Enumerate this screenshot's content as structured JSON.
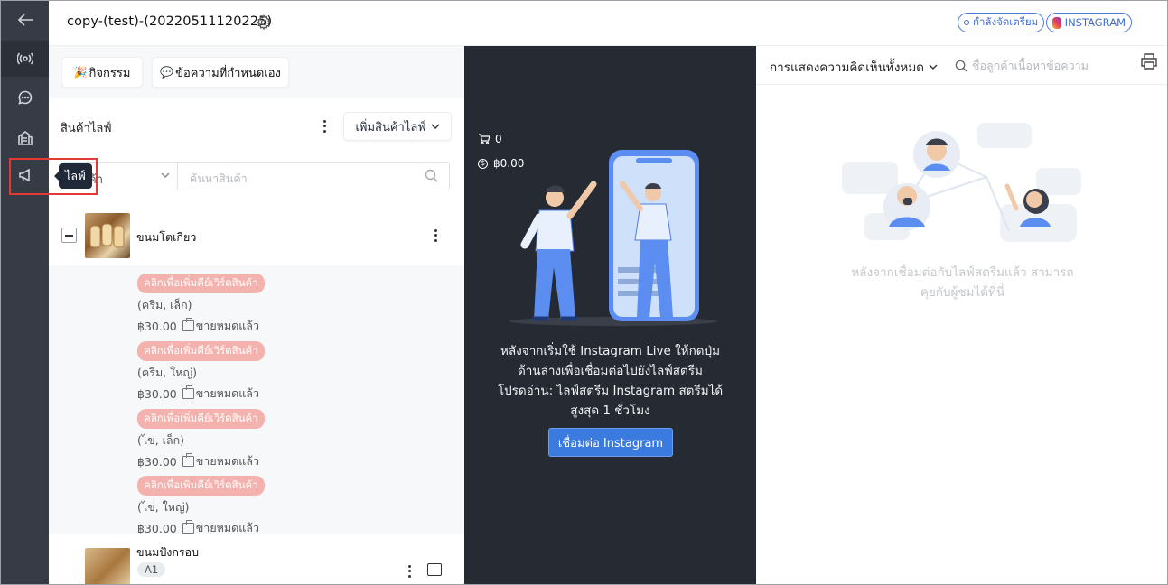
{
  "header": {
    "title": "copy-(test)-(20220511120225)",
    "status_badge": "กำลังจัดเตรียม",
    "platform_badge": "INSTAGRAM"
  },
  "rail": {
    "items": [
      "back-icon",
      "live-icon",
      "chat-icon",
      "shop-icon",
      "megaphone-icon"
    ]
  },
  "tooltip": "ไลฟ์",
  "left": {
    "tabs": [
      "กิจกรรม",
      "ข้อความที่กำหนดเอง"
    ],
    "section_title": "สินค้าไลฟ์",
    "add_button": "เพิ่มสินค้าไลฟ์",
    "filter_select": "ค้า",
    "search_placeholder": "ค้นหาสินค้า",
    "products": [
      {
        "name": "ขนมโตเกียว",
        "variants": [
          {
            "tag": "คลิกเพื่อเพิ่มคีย์เวิร์ดสินค้า",
            "name": "(ครีม, เล็ก)",
            "price": "฿30.00",
            "stock": "ขายหมดแล้ว"
          },
          {
            "tag": "คลิกเพื่อเพิ่มคีย์เวิร์ดสินค้า",
            "name": "(ครีม, ใหญ่)",
            "price": "฿30.00",
            "stock": "ขายหมดแล้ว"
          },
          {
            "tag": "คลิกเพื่อเพิ่มคีย์เวิร์ดสินค้า",
            "name": "(ไข่, เล็ก)",
            "price": "฿30.00",
            "stock": "ขายหมดแล้ว"
          },
          {
            "tag": "คลิกเพื่อเพิ่มคีย์เวิร์ดสินค้า",
            "name": "(ไข่, ใหญ่)",
            "price": "฿30.00",
            "stock": "ขายหมดแล้ว"
          }
        ]
      },
      {
        "name": "ขนมปังกรอบ",
        "keyword": "A1"
      }
    ]
  },
  "center": {
    "cart_count": "0",
    "amount": "฿0.00",
    "instruction_1": "หลังจากเริ่มใช้ Instagram Live ให้กดปุ่ม",
    "instruction_2": "ด้านล่างเพื่อเชื่อมต่อไปยังไลฟ์สตรีม",
    "instruction_3": "โปรดอ่าน: ไลฟ์สตรีม Instagram สตรีมได้",
    "instruction_4": "สูงสุด 1 ชั่วโมง",
    "connect_button": "เชื่อมต่อ Instagram"
  },
  "right": {
    "filter_dropdown": "การแสดงความคิดเห็นทั้งหมด",
    "search_placeholder": "ชื่อลูกค้าเนื้อหาข้อความ",
    "empty_text_1": "หลังจากเชื่อมต่อกับไลฟ์สตรีมแล้ว สามารถ",
    "empty_text_2": "คุยกับผู้ชมได้ที่นี่"
  },
  "colors": {
    "rail_bg": "#373b45",
    "center_bg": "#262a33",
    "accent": "#3b7be0",
    "keyword_pill": "#f3b2ad",
    "highlight": "#e53935"
  }
}
